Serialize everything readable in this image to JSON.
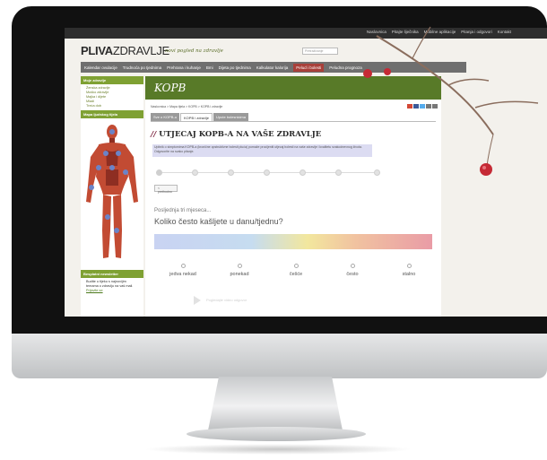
{
  "topbar": {
    "links": [
      "Naslovnica",
      "Pitajte liječnika",
      "Mobilne aplikacije",
      "Pitanja i odgovori",
      "Kontakt"
    ]
  },
  "brand": {
    "logo_bold": "PLIVA",
    "logo_light": "ZDRAVLJE",
    "tagline": "novi pogled na zdravlje"
  },
  "search": {
    "placeholder": "Pretraživanje"
  },
  "mainnav": {
    "items": [
      "Kalendar ovulacije",
      "Trudnoća po tjednima",
      "Prehrana i kuhanje",
      "Bmi",
      "Dijeta po tjednima",
      "Kalkulator kalorija",
      "Pelud i bolesti",
      "Peludna prognoza"
    ]
  },
  "sidebar": {
    "heading1": "Moje zdravlje",
    "items": [
      "Ženska zdravlje",
      "Muško zdravlje",
      "Majka i dijete",
      "Mladi",
      "Treća dob"
    ],
    "heading2": "Mapa ljudskog tijela",
    "heading3": "Besplatni newsletter",
    "newsletter_text": "Budite u tijeku s najnovijim temama o zdravlju na vaš mail.",
    "newsletter_link": "Prijavite se"
  },
  "content": {
    "section_title": "KOPB",
    "breadcrumb": "Naslovnica > Mapa tijela > KOPB > KOPB i zdravlje",
    "tabs": [
      "Sve o KOPB-u",
      "KOPB i zdravlje",
      "Upute bolesnicima"
    ],
    "heading_mark": "//",
    "heading": "UTJECAJ KOPB-A NA VAŠE ZDRAVLJE",
    "intro": "Upitnik o simptomima KOPB-a (kronične opstruktivne bolesti pluća) pomaže procijeniti utjecaj bolesti na vaše zdravlje i kvalitetu svakodnevnog života. Odgovorite na svako pitanje.",
    "back_button": "< prethodno",
    "subtitle": "Posljednja tri mjeseca...",
    "question": "Koliko često kašljete u danu/tjednu?",
    "options": [
      "jedva nekad",
      "ponekad",
      "češće",
      "često",
      "stalno"
    ],
    "video_label": "Pogledajte video odgovor"
  },
  "colors": {
    "accent_green": "#587a28",
    "nav_active": "#a8403a",
    "berry": "#c52a35"
  }
}
